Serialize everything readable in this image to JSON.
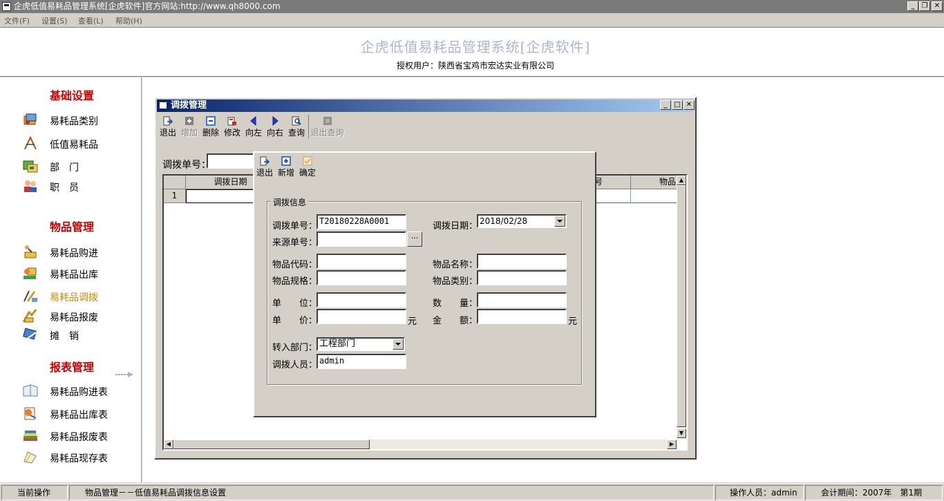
{
  "window": {
    "title": "企虎低值易耗品管理系统[企虎软件]官方网站:http://www.qh8000.com",
    "min_glyph": "_",
    "restore_glyph": "❐",
    "close_glyph": "✕"
  },
  "menu": [
    {
      "label": "文件(F)"
    },
    {
      "label": "设置(S)"
    },
    {
      "label": "查看(L)"
    },
    {
      "label": "帮助(H)"
    }
  ],
  "header": {
    "app_title": "企虎低值易耗品管理系统[企虎软件]",
    "license": "授权用户：陕西省宝鸡市宏达实业有限公司"
  },
  "sidebar": {
    "sections": [
      {
        "title": "基础设置",
        "items": [
          {
            "label": "易耗品类别",
            "icon": "category-icon"
          },
          {
            "label": "低值易耗品",
            "icon": "tools-icon"
          },
          {
            "label": "部　门",
            "icon": "department-icon"
          },
          {
            "label": "职　员",
            "icon": "staff-icon"
          }
        ]
      },
      {
        "title": "物品管理",
        "items": [
          {
            "label": "易耗品购进",
            "icon": "purchase-icon"
          },
          {
            "label": "易耗品出库",
            "icon": "outbound-icon"
          },
          {
            "label": "易耗品调拨",
            "icon": "transfer-icon"
          },
          {
            "label": "易耗品报废",
            "icon": "scrap-icon"
          },
          {
            "label": "摊　销",
            "icon": "amortize-icon"
          }
        ]
      },
      {
        "title": "报表管理",
        "items": [
          {
            "label": "易耗品购进表",
            "icon": "purchase-report-icon"
          },
          {
            "label": "易耗品出库表",
            "icon": "outbound-report-icon"
          },
          {
            "label": "易耗品报废表",
            "icon": "scrap-report-icon"
          },
          {
            "label": "易耗品现存表",
            "icon": "stock-report-icon"
          }
        ]
      }
    ],
    "active_item": "易耗品调拨"
  },
  "child_window": {
    "title": "调拨管理",
    "toolbar": [
      {
        "label": "退出",
        "icon": "exit-icon",
        "enabled": true
      },
      {
        "label": "增加",
        "icon": "add-icon",
        "enabled": false
      },
      {
        "label": "删除",
        "icon": "delete-icon",
        "enabled": true
      },
      {
        "label": "修改",
        "icon": "edit-icon",
        "enabled": true
      },
      {
        "label": "向左",
        "icon": "left-arrow-icon",
        "enabled": true
      },
      {
        "label": "向右",
        "icon": "right-arrow-icon",
        "enabled": true
      },
      {
        "label": "查询",
        "icon": "query-icon",
        "enabled": true
      },
      {
        "label": "退出查询",
        "icon": "exit-query-icon",
        "enabled": false
      }
    ],
    "search_label": "调拨单号：",
    "search_value": "",
    "grid": {
      "columns": [
        "调拨日期",
        "号",
        "物品"
      ],
      "rows": [
        {
          "num": "1",
          "cells": [
            "",
            "",
            ""
          ]
        }
      ]
    }
  },
  "dialog": {
    "toolbar": [
      {
        "label": "退出",
        "icon": "exit-icon"
      },
      {
        "label": "新增",
        "icon": "add-icon"
      },
      {
        "label": "确定",
        "icon": "confirm-icon"
      }
    ],
    "group_title": "调拨信息",
    "fields": {
      "transfer_no": {
        "label": "调拨单号：",
        "value": "T20180228A0001"
      },
      "transfer_date": {
        "label": "调拨日期：",
        "value": "2018/02/28"
      },
      "source_no": {
        "label": "来源单号：",
        "value": "",
        "button": "···"
      },
      "item_code": {
        "label": "物品代码：",
        "value": ""
      },
      "item_name": {
        "label": "物品名称：",
        "value": ""
      },
      "item_spec": {
        "label": "物品规格：",
        "value": ""
      },
      "item_category": {
        "label": "物品类别：",
        "value": ""
      },
      "unit": {
        "label": "单　　位：",
        "value": ""
      },
      "quantity": {
        "label": "数　　量：",
        "value": ""
      },
      "price": {
        "label": "单　　价：",
        "value": "",
        "suffix": "元"
      },
      "amount": {
        "label": "金　　额：",
        "value": "",
        "suffix": "元"
      },
      "to_department": {
        "label": "转入部门：",
        "value": "工程部门"
      },
      "operator": {
        "label": "调拨人员：",
        "value": "admin"
      }
    }
  },
  "statusbar": {
    "current_op_label": "当前操作",
    "current_op": "物品管理－－低值易耗品调拨信息设置",
    "operator": "操作人员：admin",
    "period": "会计期间：2007年　第1期"
  },
  "colors": {
    "accent_red": "#cc0000",
    "active_orange": "#d48a00",
    "title_blue": "#0a246a",
    "app_title_color": "#aeb4d8"
  }
}
